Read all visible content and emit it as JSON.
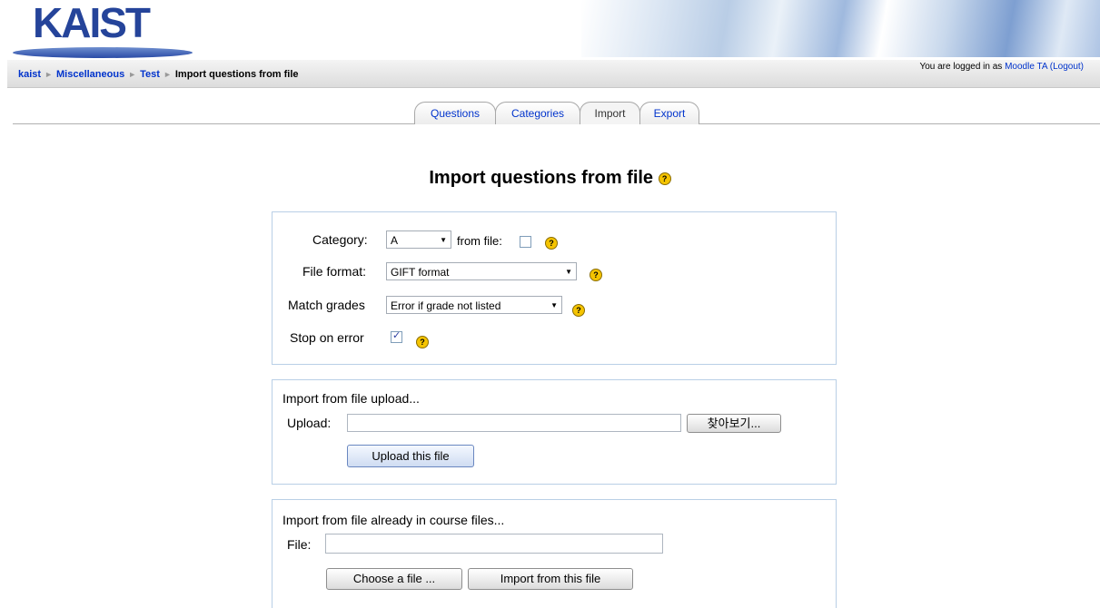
{
  "header": {
    "logo_text": "KAIST",
    "breadcrumb": [
      "kaist",
      "Miscellaneous",
      "Test"
    ],
    "breadcrumb_current": "Import questions from file",
    "login_prefix": "You are logged in as",
    "login_user": "Moodle TA",
    "logout_label": "(Logout)"
  },
  "tabs": [
    {
      "label": "Questions",
      "active": false
    },
    {
      "label": "Categories",
      "active": false
    },
    {
      "label": "Import",
      "active": true
    },
    {
      "label": "Export",
      "active": false
    }
  ],
  "page_title": "Import questions from file",
  "help_glyph": "?",
  "options": {
    "category_label": "Category:",
    "category_value": "A",
    "from_file_label": "from file:",
    "from_file_checked": false,
    "file_format_label": "File format:",
    "file_format_value": "GIFT format",
    "match_grades_label": "Match grades",
    "match_grades_value": "Error if grade not listed",
    "stop_on_error_label": "Stop on error",
    "stop_on_error_checked": true
  },
  "upload": {
    "heading": "Import from file upload...",
    "upload_label": "Upload:",
    "upload_value": "",
    "browse_label": "찾아보기...",
    "submit_label": "Upload this file"
  },
  "course_files": {
    "heading": "Import from file already in course files...",
    "file_label": "File:",
    "file_value": "",
    "choose_label": "Choose a file ...",
    "import_label": "Import from this file"
  }
}
